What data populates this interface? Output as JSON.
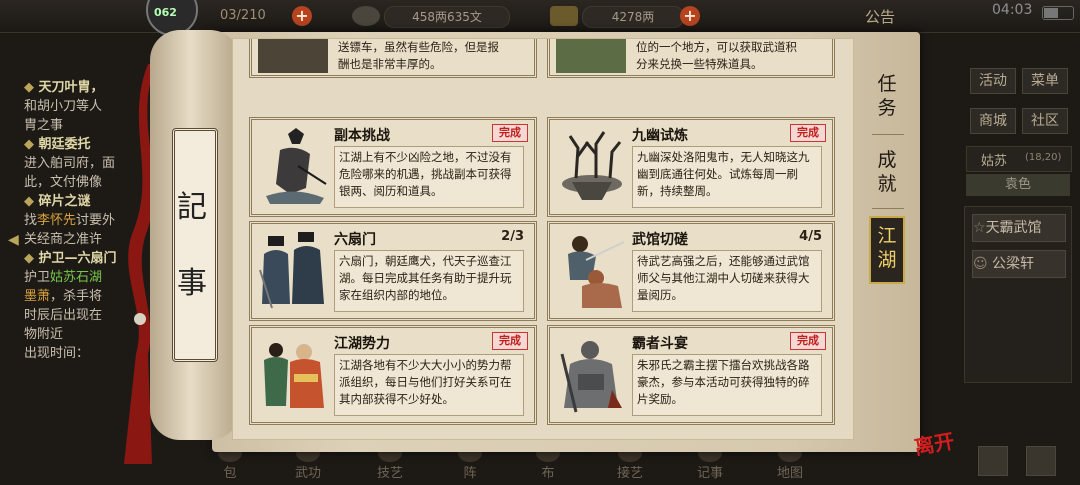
{
  "topbar": {
    "gauge_value": "062",
    "stamina": "03/210",
    "copper": "458两635文",
    "silver": "4278两",
    "notice": "公告",
    "clock": "04:03"
  },
  "left_panel": {
    "q1_title": "天刀叶胄，",
    "q1_l1": "和胡小刀等人",
    "q1_l2": "胄之事",
    "q2_title": "朝廷委托",
    "q2_l1": "进入舶司府，面",
    "q2_l2": "此，文付佛像",
    "q3_title": "碎片之谜",
    "q3_l1_pre": "找",
    "q3_l1_hl": "李怀先",
    "q3_l1_post": "讨要外",
    "q3_l2": "关经商之准许",
    "q4_title": "护卫—六扇门",
    "q4_l1_pre": "护卫",
    "q4_l1_hl": "姑苏石湖",
    "q4_l2_hl": "墨萧",
    "q4_l2_post": "，杀手将",
    "q4_l3": "时辰后出现在",
    "q4_l4": "物附近",
    "q4_l5": "出现时间："
  },
  "right_hud": {
    "btn_activity": "活动",
    "btn_menu": "菜单",
    "btn_shop": "商城",
    "btn_community": "社区",
    "location": "姑苏",
    "coords": "(18,20)",
    "exit_label": "袁色",
    "place1": "天霸武馆",
    "place2": "公梁轩"
  },
  "scroll": {
    "title_c1": "記",
    "title_c2": "事",
    "tabs": {
      "task": "任务",
      "achieve": "成就",
      "jianghu": "江湖"
    },
    "leave": "离开",
    "partial_left": "送镖车，虽然有些危险，但是报\n酬也是非常丰厚的。",
    "partial_right": "位的一个地方，可以获取武道积\n分来兑换一些特殊道具。",
    "cards": [
      {
        "title": "副本挑战",
        "status": "完成",
        "desc": "江湖上有不少凶险之地，不过没有危险哪来的机遇，挑战副本可获得银两、阅历和道具。"
      },
      {
        "title": "九幽试炼",
        "status": "完成",
        "desc": "九幽深处洛阳鬼市，无人知晓这九幽到底通往何处。试炼每周一刷新，持续整周。"
      },
      {
        "title": "六扇门",
        "progress": "2/3",
        "desc": "六扇门，朝廷鹰犬，代天子巡查江湖。每日完成其任务有助于提升玩家在组织内部的地位。"
      },
      {
        "title": "武馆切磋",
        "progress": "4/5",
        "desc": "待武艺高强之后，还能够通过武馆师父与其他江湖中人切磋来获得大量阅历。"
      },
      {
        "title": "江湖势力",
        "status": "完成",
        "desc": "江湖各地有不少大大小小的势力帮派组织，每日与他们打好关系可在其内部获得不少好处。"
      },
      {
        "title": "霸者斗宴",
        "status": "完成",
        "desc": "朱邪氏之霸主摆下擂台欢挑战各路豪杰，参与本活动可获得独特的碎片奖励。"
      }
    ]
  },
  "bottom_nav": [
    "包",
    "武功",
    "技艺",
    "阵",
    "布",
    "接艺",
    "记事",
    "地图"
  ]
}
